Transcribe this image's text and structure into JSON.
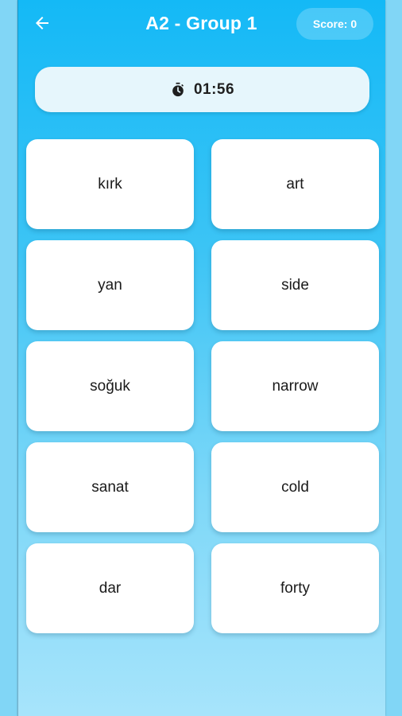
{
  "header": {
    "title": "A2 - Group 1",
    "score_label": "Score: 0"
  },
  "timer": {
    "icon": "stopwatch-icon",
    "value": "01:56"
  },
  "cards": [
    {
      "label": "kırk"
    },
    {
      "label": "art"
    },
    {
      "label": "yan"
    },
    {
      "label": "side"
    },
    {
      "label": "soğuk"
    },
    {
      "label": "narrow"
    },
    {
      "label": "sanat"
    },
    {
      "label": "cold"
    },
    {
      "label": "dar"
    },
    {
      "label": "forty"
    }
  ],
  "colors": {
    "header_bg": "#14b9f6",
    "page_bg": "#81d6f6",
    "card_bg": "#ffffff",
    "timer_bg": "#e6f6fc"
  }
}
